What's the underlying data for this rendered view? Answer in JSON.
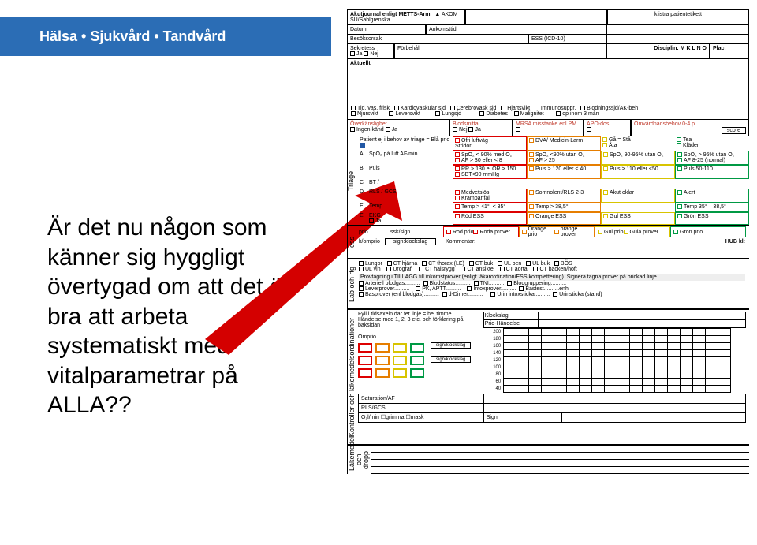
{
  "banner": {
    "text": "Hälsa • Sjukvård • Tandvård"
  },
  "question": {
    "text": "Är det nu någon som känner sig hyggligt övertygad om att det är bra att arbeta systematiskt med vitalparametrar på ALLA??"
  },
  "form": {
    "header": {
      "title": "Akutjournal enligt METTS-Arm",
      "logo_text": "AKOM SU/Sahlgrenska",
      "sticker": "klistra patientetikett",
      "datum": "Datum",
      "ankomsttid": "Ankomsttid",
      "besoksorsak": "Besöksorsak",
      "ess": "ESS (ICD-10)"
    },
    "sekretess": {
      "label": "Sekretess",
      "ja": "Ja",
      "nej": "Nej",
      "forbehall": "Förbehåll",
      "disciplin": "Disciplin: M  K  L  N  O",
      "plac": "Plac:"
    },
    "aktuellt": "Aktuellt",
    "history": {
      "tid_vas": "Tid. väs. frisk",
      "kardio": "Kardiovaskulär sjd",
      "cerebro": "Cerebrovask sjd",
      "hjartsvikt": "Hjärtsvikt",
      "immunosuppr": "Immunosuppr.",
      "blodning": "Blödningssjd/AK-beh",
      "njursvikt": "Njursvikt",
      "leversvikt": "Leversvikt",
      "lungsjd": "Lungsjd",
      "diabetes": "Diabetes",
      "malignitet": "Malignitet",
      "op3man": "op inom 3 mån"
    },
    "overkans": {
      "label": "Överkänslighet",
      "ingen": "Ingen känd",
      "ja": "Ja",
      "blodsmitta": "Blodsmitta",
      "nej": "Nej",
      "ja2": "Ja",
      "mrsa": "MRSA misstanke enl PM",
      "apo": "APO-dos",
      "omv": "Omvårdnadsbehov 0-4 p",
      "score": "score"
    },
    "triage": {
      "side": "Triage",
      "bla": "Patient ej i behov av triage      = Blå prio",
      "row_a": "SpO₂ på luft   AF/min",
      "row_b": "Puls",
      "row_c": "BT                        /",
      "row_d": "RLS / GCS",
      "row_e": "Temp",
      "row_f": "EKG",
      "ja": "Ja",
      "cols": {
        "red": {
          "r1": "Ofri luftväg",
          "r2": "Stridor",
          "r3": "SpO₂ < 90%  med O₂",
          "r4": "AF > 30 eller < 8",
          "r5": "RR > 130 el OR > 150",
          "r6": "SBT<90 mmHg",
          "r7": "Medvetslös",
          "r8": "Krampanfall",
          "r9": "Temp > 41°, < 35°"
        },
        "orange": {
          "r1": "DVA/ Medicin-Larm",
          "r3": "SpO₂ <90% utan O₂",
          "r4": "AF > 25",
          "r5": "Puls > 120 eller < 40",
          "r7": "Somnolent/RLS 2-3",
          "r9": "Temp > 38,5°"
        },
        "yellow": {
          "r0a": "Gå = Stå",
          "r0b": "Åta",
          "r3": "SpO₂ 90-95% utan O₂",
          "r5": "Puls > 110 eller <50",
          "r7": "Akut oklar"
        },
        "green": {
          "r0a": "Tea",
          "r0b": "Kläder",
          "r3": "SpO₂ > 95% utan O₂",
          "r4": "AF 8-25 (normal)",
          "r5": "Puls 50-110",
          "r7": "Alert",
          "r9": "Temp 35° – 38,5°"
        }
      },
      "ess_row": {
        "red": "Röd ESS",
        "orange": "Orange ESS",
        "yellow": "Gul ESS",
        "green": "Grön ESS"
      }
    },
    "process": {
      "side": "ess",
      "prio": "prio",
      "ssk": "ssk/sign",
      "red1": "Röd prio",
      "red2": "Röda prover",
      "orange1": "Orange prio",
      "orange2": "orange prover",
      "yellow1": "Gul prio",
      "yellow2": "Gula prover",
      "green1": "Grön prio",
      "komm": "k/omprio",
      "sign": "sign:klockslag",
      "kommentar": "Kommentar:",
      "hub": "HUB kl:"
    },
    "lab": {
      "side": "Lab och rtg",
      "row1": [
        "Lungor",
        "CT hjärna",
        "CT thorax (LE)",
        "CT buk",
        "UL ben",
        "UL buk",
        "BÖS"
      ],
      "row2": [
        "UL vin",
        "Urografi",
        "CT halsrygg",
        "CT ansikte",
        "CT aorta",
        "CT bäcken/höft"
      ],
      "instr": "Provtagning i TILLÄGG till inkomstprover (enligt läkarordination/ESS komplettering). Signera tagna prover på prickad linje.",
      "row3": [
        "Arteriell blodgas..........",
        "Blodstatus..........",
        "TNI..........",
        "Blodgruppering.........."
      ],
      "row4": [
        "Leverprover..........",
        "PK, APTT..........",
        "Intoxprover..........",
        "Bastest..........enh"
      ],
      "row5": [
        "Basprover (enl blodgas)..........",
        "d-Dimer..........",
        "Urin intoxsticka..........",
        "Urinsticka (stand)"
      ]
    },
    "monitor": {
      "side": "Kontroller och läkemedelsordinationer",
      "instr": "Fyll i tidsaxeln där fet linje = hel timme",
      "handelse": "Händelse med 1, 2, 3 etc. och förklaring på baksidan",
      "rows": [
        "200",
        "180",
        "160",
        "140",
        "120",
        "100",
        "80",
        "60",
        "40"
      ],
      "klockslag": "Klockslag",
      "prio_h": "Prio-Händelse",
      "omprio": "Omprio",
      "sign1": "sign/klockslag",
      "sign2": "sign/klockslag",
      "sat": "Saturation/AF",
      "rls": "RLS/GCS",
      "o2": "O₂l/min ☐grimma ☐mask",
      "sign": "Sign"
    },
    "med": {
      "side": "Läkemedel och dropp"
    }
  }
}
